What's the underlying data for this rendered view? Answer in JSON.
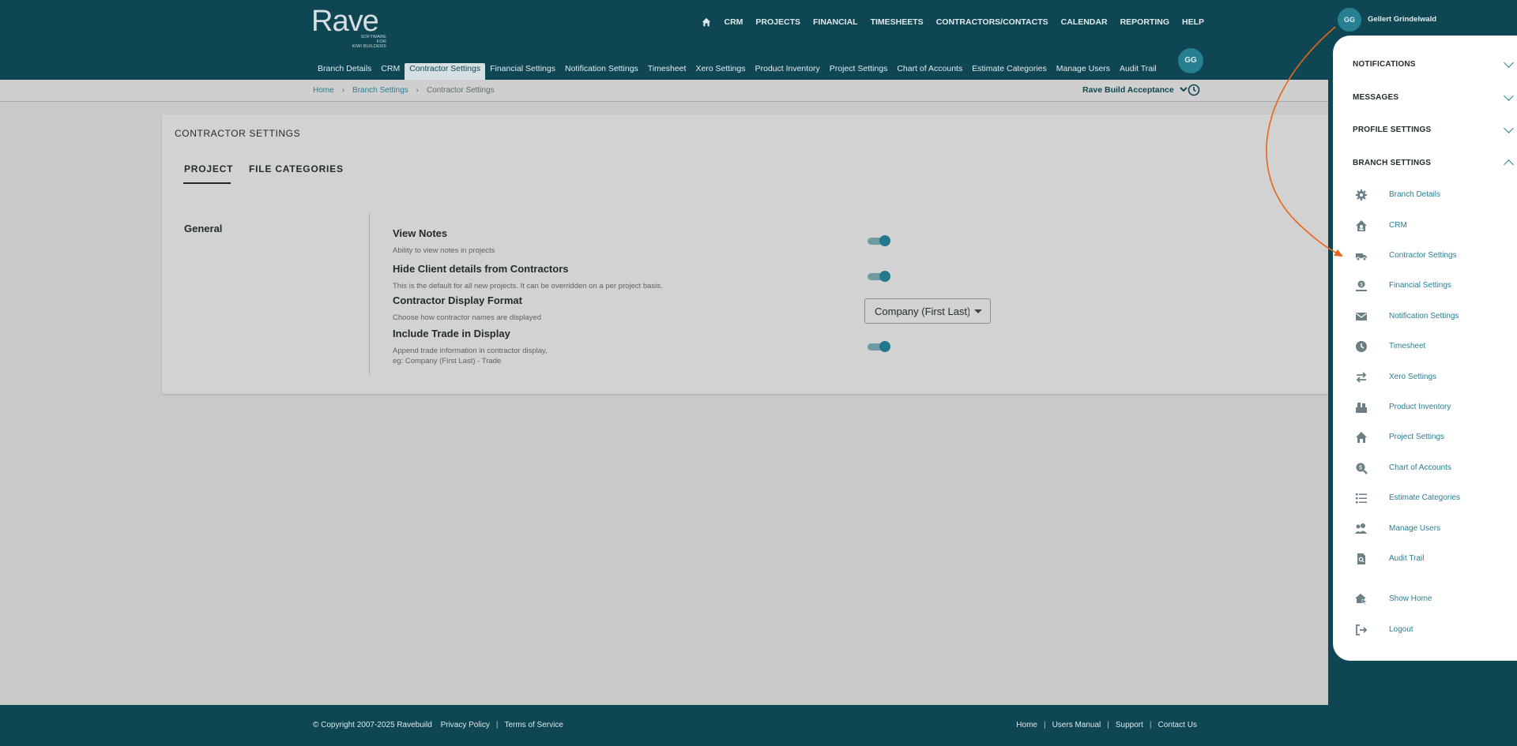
{
  "brand": {
    "name": "Rave",
    "tagline_line1": "SOFTWARE FOR",
    "tagline_line2": "KIWI BUILDERS"
  },
  "main_nav": [
    "CRM",
    "PROJECTS",
    "FINANCIAL",
    "TIMESHEETS",
    "CONTRACTORS/CONTACTS",
    "CALENDAR",
    "REPORTING",
    "HELP"
  ],
  "sub_nav": [
    "Branch Details",
    "CRM",
    "Contractor Settings",
    "Financial Settings",
    "Notification Settings",
    "Timesheet",
    "Xero Settings",
    "Product Inventory",
    "Project Settings",
    "Chart of Accounts",
    "Estimate Categories",
    "Manage Users",
    "Audit Trail"
  ],
  "sub_nav_active": "Contractor Settings",
  "avatar_initials": "GG",
  "breadcrumb": {
    "home": "Home",
    "branch_settings": "Branch Settings",
    "current": "Contractor Settings"
  },
  "branch_selector": "Rave Build Acceptance",
  "page": {
    "title": "CONTRACTOR SETTINGS",
    "tabs": [
      "PROJECT",
      "FILE CATEGORIES"
    ],
    "section": "General",
    "settings": [
      {
        "title": "View Notes",
        "desc": "Ability to view notes in projects",
        "type": "toggle",
        "on": true
      },
      {
        "title": "Hide Client details from Contractors",
        "desc": "This is the default for all new projects. It can be overridden on a per project basis.",
        "type": "toggle",
        "on": true
      },
      {
        "title": "Contractor Display Format",
        "desc": "Choose how contractor names are displayed",
        "type": "select",
        "value": "Company (First Last)"
      },
      {
        "title": "Include Trade in Display",
        "desc_line1": "Append trade information in contractor display,",
        "desc_line2": "eg: Company (First Last) - Trade",
        "type": "toggle",
        "on": true
      }
    ]
  },
  "footer": {
    "copyright": "© Copyright 2007-2025 Ravebuild",
    "privacy": "Privacy Policy",
    "terms": "Terms of Service",
    "links": [
      "Home",
      "Users Manual",
      "Support",
      "Contact Us"
    ]
  },
  "panel": {
    "user_initials": "GG",
    "user_name": "Gellert Grindelwald",
    "headers": [
      "NOTIFICATIONS",
      "MESSAGES",
      "PROFILE SETTINGS",
      "BRANCH SETTINGS"
    ],
    "items": [
      {
        "label": "Branch Details",
        "icon": "gear-icon"
      },
      {
        "label": "CRM",
        "icon": "house-user-icon"
      },
      {
        "label": "Contractor Settings",
        "icon": "truck-icon"
      },
      {
        "label": "Financial Settings",
        "icon": "money-hand-icon"
      },
      {
        "label": "Notification Settings",
        "icon": "envelope-icon"
      },
      {
        "label": "Timesheet",
        "icon": "clock-icon"
      },
      {
        "label": "Xero Settings",
        "icon": "swap-arrows-icon"
      },
      {
        "label": "Product Inventory",
        "icon": "boxes-icon"
      },
      {
        "label": "Project Settings",
        "icon": "home-icon"
      },
      {
        "label": "Chart of Accounts",
        "icon": "search-dollar-icon"
      },
      {
        "label": "Estimate Categories",
        "icon": "list-icon"
      },
      {
        "label": "Manage Users",
        "icon": "users-cog-icon"
      },
      {
        "label": "Audit Trail",
        "icon": "file-search-icon"
      },
      {
        "label": "Show Home",
        "icon": "home-cursor-icon"
      },
      {
        "label": "Logout",
        "icon": "logout-icon"
      }
    ]
  },
  "colors": {
    "primary": "#0e4654",
    "accent": "#277f92",
    "overlay_bg": "#c9c9c9",
    "annotation": "#e8651a"
  }
}
